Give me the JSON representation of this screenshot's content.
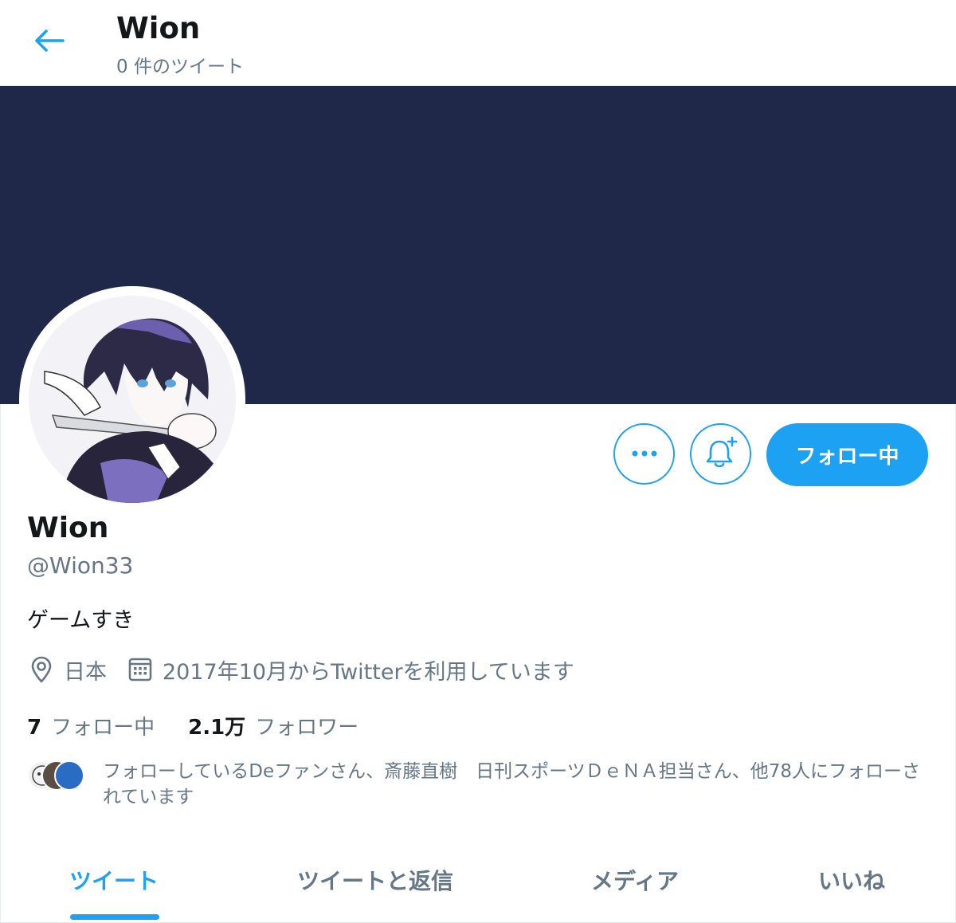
{
  "header": {
    "title": "Wion",
    "tweet_count": "0 件のツイート"
  },
  "profile": {
    "display_name": "Wion",
    "handle": "@Wion33",
    "bio": "ゲームすき",
    "location": "日本",
    "joined": "2017年10月からTwitterを利用しています",
    "follow_button_label": "フォロー中"
  },
  "stats": {
    "following_count": "7",
    "following_label": "フォロー中",
    "followers_count": "2.1万",
    "followers_label": "フォロワー"
  },
  "followers_you_know": {
    "text": "フォローしているDeファンさん、斎藤直樹　日刊スポーツＤｅＮＡ担当さん、他78人にフォローされています"
  },
  "tabs": [
    {
      "label": "ツイート",
      "active": true
    },
    {
      "label": "ツイートと返信",
      "active": false
    },
    {
      "label": "メディア",
      "active": false
    },
    {
      "label": "いいね",
      "active": false
    }
  ],
  "colors": {
    "accent": "#1da1f2",
    "banner": "#1f2848",
    "secondary_text": "#657786"
  },
  "icons": {
    "back": "arrow-left-icon",
    "more": "more-dots-icon",
    "notify": "bell-plus-icon",
    "location": "location-pin-icon",
    "calendar": "calendar-icon"
  }
}
